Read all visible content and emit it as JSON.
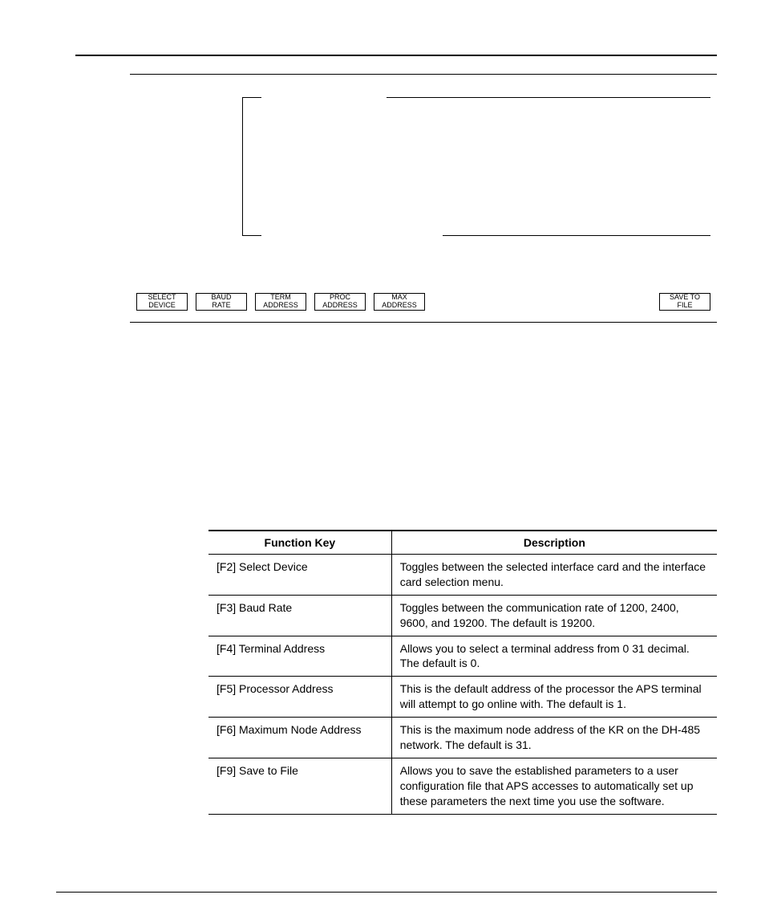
{
  "panel": {
    "fkeys": [
      {
        "line1": "SELECT",
        "line2": "DEVICE"
      },
      {
        "line1": "BAUD",
        "line2": "RATE"
      },
      {
        "line1": "TERM",
        "line2": "ADDRESS"
      },
      {
        "line1": "PROC",
        "line2": "ADDRESS"
      },
      {
        "line1": "MAX",
        "line2": "ADDRESS"
      },
      {
        "line1": "SAVE TO",
        "line2": "FILE"
      }
    ]
  },
  "table": {
    "headers": {
      "col1": "Function Key",
      "col2": "Description"
    },
    "rows": [
      {
        "key": "[F2] Select Device",
        "desc": "Toggles between the selected interface card and the interface card selection menu."
      },
      {
        "key": "[F3] Baud Rate",
        "desc": "Toggles between the communication rate of 1200, 2400, 9600, and 19200.  The default is 19200."
      },
      {
        "key": "[F4] Terminal Address",
        "desc": "Allows you to select a terminal address from 0  31 decimal.  The default is 0."
      },
      {
        "key": "[F5] Processor Address",
        "desc": "This is the default address of the processor the APS terminal will attempt to go online with.  The default is 1."
      },
      {
        "key": "[F6] Maximum Node Address",
        "desc": "This is the maximum node address of the KR on the DH-485 network.  The default is 31."
      },
      {
        "key": "[F9] Save to File",
        "desc": "Allows you to save the established parameters to a user configuration file that APS accesses to automatically set up these parameters the next time you use the software."
      }
    ]
  }
}
